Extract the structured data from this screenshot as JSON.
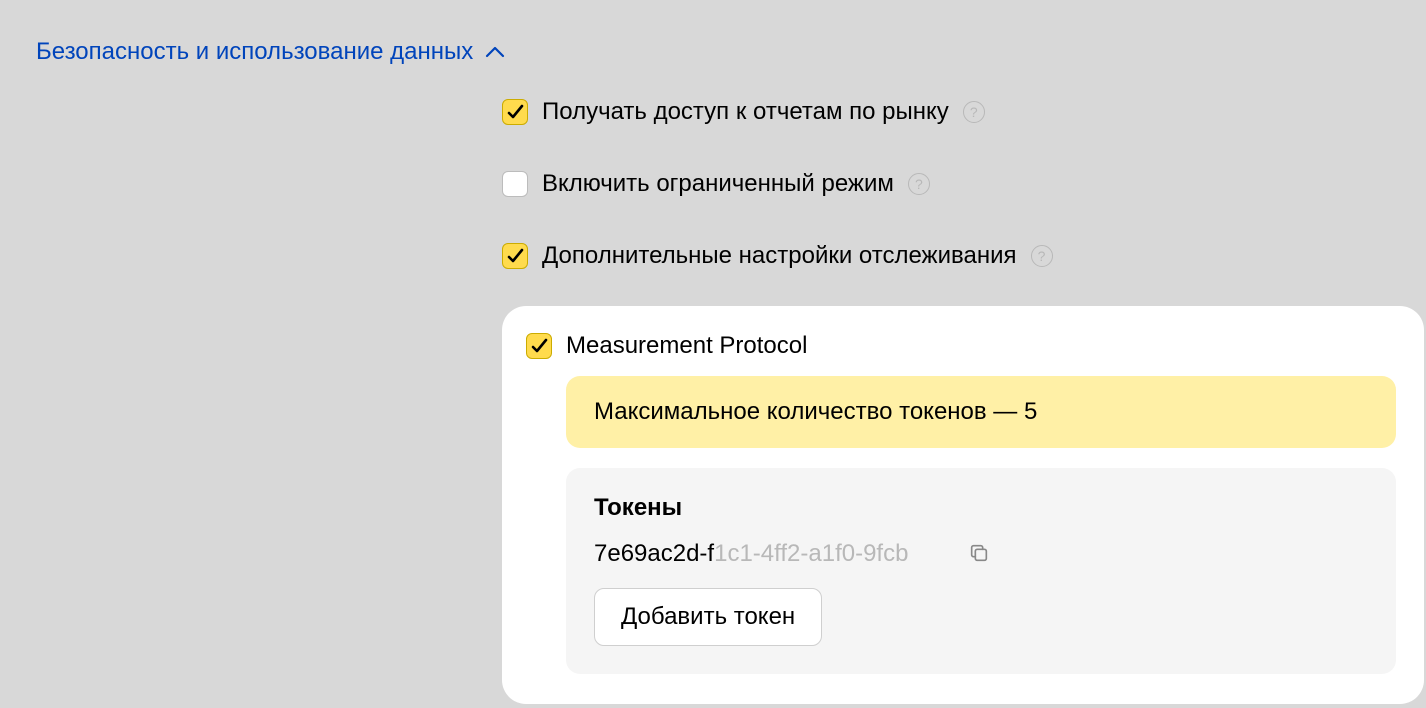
{
  "section": {
    "title": "Безопасность и использование данных"
  },
  "options": {
    "market_reports": {
      "label": "Получать доступ к отчетам по рынку",
      "checked": true
    },
    "limited_mode": {
      "label": "Включить ограниченный режим",
      "checked": false
    },
    "extra_tracking": {
      "label": "Дополнительные настройки отслеживания",
      "checked": true
    },
    "measurement_protocol": {
      "label": "Measurement Protocol",
      "checked": true
    }
  },
  "mp": {
    "banner": "Максимальное количество токенов — 5",
    "tokens_heading": "Токены",
    "token_visible": "7e69ac2d-f",
    "token_masked": "1c1-4ff2-a1f0-9fcb",
    "add_token_label": "Добавить токен"
  }
}
